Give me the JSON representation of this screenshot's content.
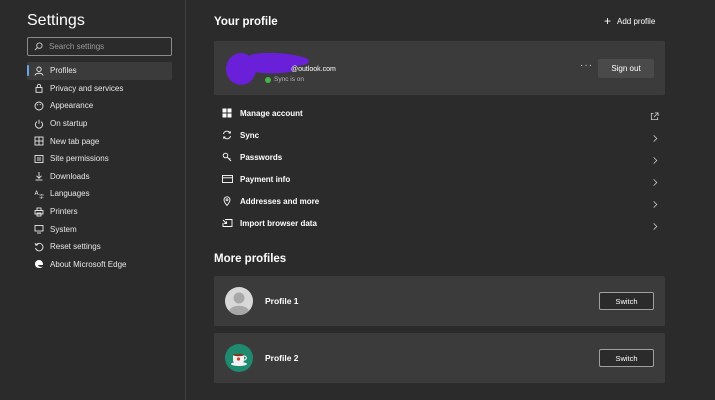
{
  "sidebar": {
    "title": "Settings",
    "search_placeholder": "Search settings",
    "items": [
      {
        "label": "Profiles",
        "icon": "person-icon",
        "active": true
      },
      {
        "label": "Privacy and services",
        "icon": "lock-icon"
      },
      {
        "label": "Appearance",
        "icon": "palette-icon"
      },
      {
        "label": "On startup",
        "icon": "power-icon"
      },
      {
        "label": "New tab page",
        "icon": "grid-icon"
      },
      {
        "label": "Site permissions",
        "icon": "site-permissions-icon"
      },
      {
        "label": "Downloads",
        "icon": "download-icon"
      },
      {
        "label": "Languages",
        "icon": "languages-icon"
      },
      {
        "label": "Printers",
        "icon": "printer-icon"
      },
      {
        "label": "System",
        "icon": "system-icon"
      },
      {
        "label": "Reset settings",
        "icon": "reset-icon"
      },
      {
        "label": "About Microsoft Edge",
        "icon": "edge-logo-icon"
      }
    ]
  },
  "your_profile": {
    "heading": "Your profile",
    "add_profile_label": "Add profile",
    "email": "@outlook.com",
    "sync_status": "Sync is on",
    "more_label": "···",
    "sign_out_label": "Sign out",
    "menu": [
      {
        "label": "Manage account",
        "icon": "windows-logo-icon",
        "trailing": "external-link-icon"
      },
      {
        "label": "Sync",
        "icon": "sync-icon",
        "trailing": "chevron-right-icon"
      },
      {
        "label": "Passwords",
        "icon": "key-icon",
        "trailing": "chevron-right-icon"
      },
      {
        "label": "Payment info",
        "icon": "card-icon",
        "trailing": "chevron-right-icon"
      },
      {
        "label": "Addresses and more",
        "icon": "location-pin-icon",
        "trailing": "chevron-right-icon"
      },
      {
        "label": "Import browser data",
        "icon": "import-icon",
        "trailing": "chevron-right-icon"
      }
    ]
  },
  "more_profiles": {
    "heading": "More profiles",
    "profiles": [
      {
        "name": "Profile 1",
        "avatar": "default-person-avatar-icon",
        "switch_label": "Switch"
      },
      {
        "name": "Profile 2",
        "avatar": "coffee-cup-avatar-icon",
        "switch_label": "Switch"
      }
    ]
  },
  "colors": {
    "background": "#2b2b2b",
    "card": "#3b3b3b",
    "accent": "#6aa7e8",
    "sync_dot": "#47b34a",
    "redaction": "#6a1fd8"
  }
}
